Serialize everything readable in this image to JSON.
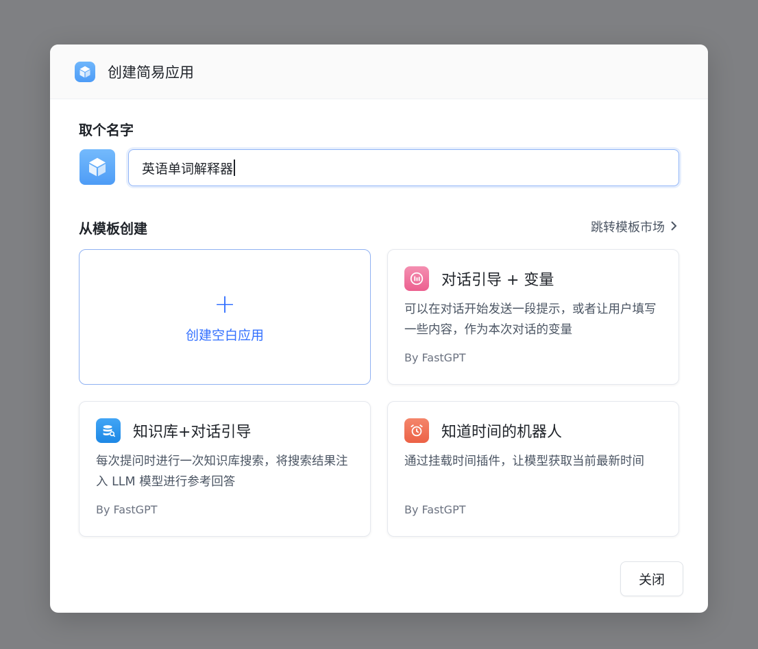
{
  "modal": {
    "title": "创建简易应用",
    "icon": "cube-icon"
  },
  "name_section": {
    "label": "取个名字",
    "input_value": "英语单词解释器"
  },
  "template_section": {
    "label": "从模板创建",
    "market_link": "跳转模板市场",
    "blank_card": {
      "plus": "+",
      "label": "创建空白应用"
    },
    "templates": [
      {
        "title": "对话引导 + 变量",
        "description": "可以在对话开始发送一段提示，或者让用户填写一些内容，作为本次对话的变量",
        "author": "By FastGPT",
        "icon": "chat-variable-icon",
        "color": "#f06292"
      },
      {
        "title": "知识库+对话引导",
        "description": "每次提问时进行一次知识库搜索，将搜索结果注入 LLM 模型进行参考回答",
        "author": "By FastGPT",
        "icon": "database-search-icon",
        "color": "#2196f3"
      },
      {
        "title": "知道时间的机器人",
        "description": "通过挂载时间插件，让模型获取当前最新时间",
        "author": "By FastGPT",
        "icon": "alarm-clock-icon",
        "color": "#f16f56"
      }
    ]
  },
  "footer": {
    "close_label": "关闭"
  },
  "colors": {
    "accent": "#3370ff",
    "overlay": "#7f8083"
  }
}
